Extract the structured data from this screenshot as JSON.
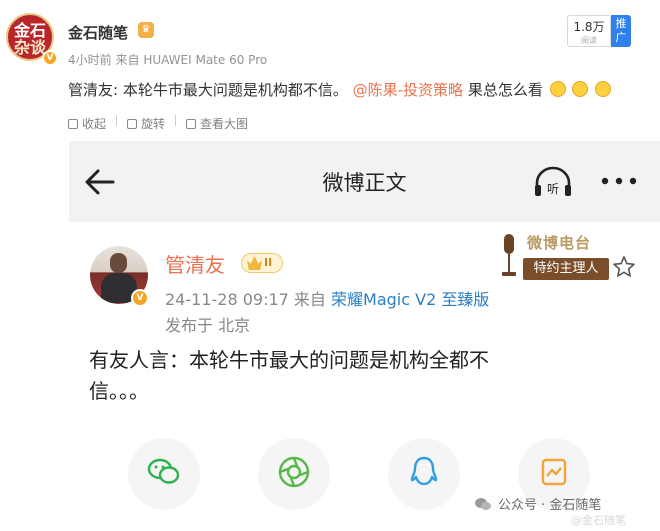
{
  "post": {
    "author": "金石随笔",
    "avatar_text_1": "金石",
    "avatar_text_2": "杂谈",
    "time": "4小时前",
    "source_prefix": "来自",
    "device": "HUAWEI Mate 60 Pro",
    "views": "1.8万",
    "views_label": "阅读",
    "promote": "推广",
    "text_before": "管清友: 本轮牛市最大问题是机构都不信。",
    "mention": "@陈果-投资策略",
    "text_after": " 果总怎么看",
    "actions": {
      "collapse": "收起",
      "rotate": "旋转",
      "view_large": "查看大图"
    }
  },
  "screenshot": {
    "title": "微博正文",
    "author": "管清友",
    "vip_level": "II",
    "timestamp": "24-11-28 09:17",
    "source_prefix": "来自",
    "device": "荣耀Magic V2 至臻版",
    "location": "发布于 北京",
    "radio_top": "微博电台",
    "radio_ribbon": "特约主理人",
    "body_line1": "有友人言：本轮牛市最大的问题是机构全都不",
    "body_line2": "信。。。"
  },
  "watermark": {
    "label": "公众号 · 金石随笔",
    "sub": "@金石随笔"
  },
  "colors": {
    "mention": "#eb7350",
    "device_link": "#2d7fc4",
    "promote": "#2f80ed",
    "wechat": "#2db24f",
    "moments": "#56b947",
    "qq": "#2f9fe0",
    "image_share": "#f2a33a"
  },
  "icons": [
    "back-arrow-icon",
    "listen-icon",
    "more-icon",
    "star-icon",
    "wechat-icon",
    "moments-icon",
    "qq-icon",
    "image-share-icon"
  ]
}
